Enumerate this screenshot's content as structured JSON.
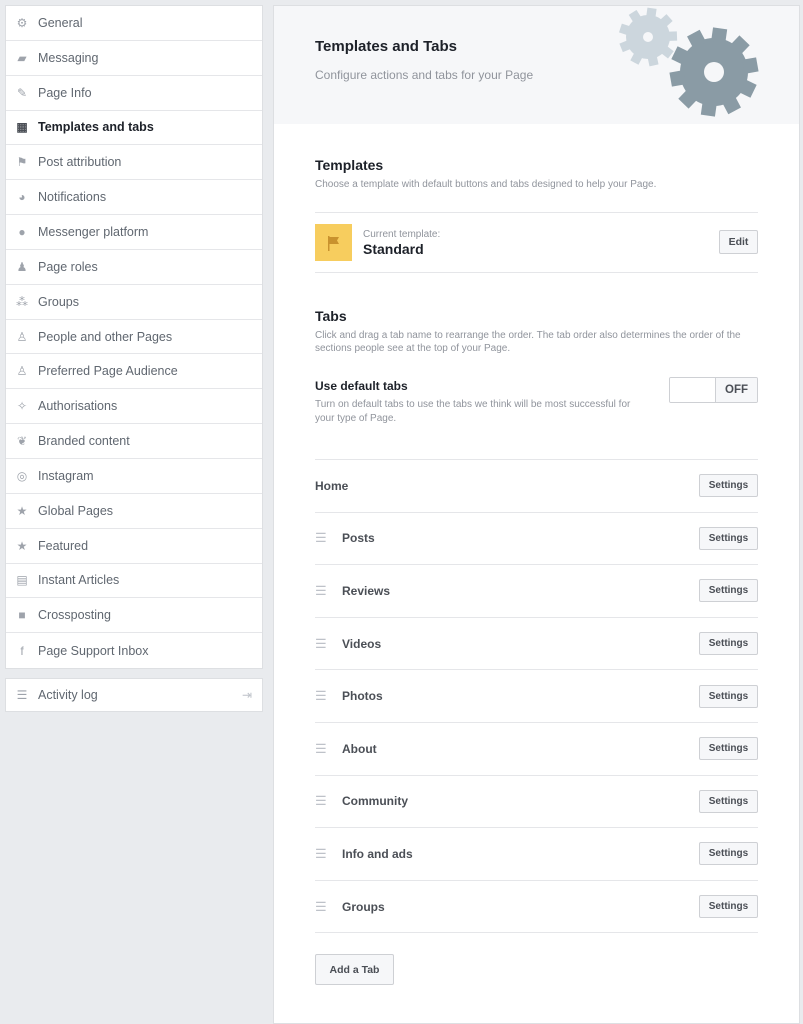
{
  "sidebar": {
    "items": [
      {
        "label": "General",
        "icon": "gear-icon",
        "glyph": "⚙"
      },
      {
        "label": "Messaging",
        "icon": "messaging-icon",
        "glyph": "▰"
      },
      {
        "label": "Page Info",
        "icon": "pencil-icon",
        "glyph": "✎"
      },
      {
        "label": "Templates and tabs",
        "icon": "grid-icon",
        "glyph": "▦",
        "active": true
      },
      {
        "label": "Post attribution",
        "icon": "flag-icon",
        "glyph": "⚑"
      },
      {
        "label": "Notifications",
        "icon": "globe-icon",
        "glyph": "◕"
      },
      {
        "label": "Messenger platform",
        "icon": "messenger-icon",
        "glyph": "●"
      },
      {
        "label": "Page roles",
        "icon": "person-icon",
        "glyph": "♟"
      },
      {
        "label": "Groups",
        "icon": "groups-icon",
        "glyph": "⁂"
      },
      {
        "label": "People and other Pages",
        "icon": "people-icon",
        "glyph": "♙"
      },
      {
        "label": "Preferred Page Audience",
        "icon": "audience-icon",
        "glyph": "♙"
      },
      {
        "label": "Authorisations",
        "icon": "wrench-icon",
        "glyph": "✧"
      },
      {
        "label": "Branded content",
        "icon": "handshake-icon",
        "glyph": "❦"
      },
      {
        "label": "Instagram",
        "icon": "instagram-icon",
        "glyph": "◎"
      },
      {
        "label": "Global Pages",
        "icon": "star-icon",
        "glyph": "★"
      },
      {
        "label": "Featured",
        "icon": "star-icon",
        "glyph": "★"
      },
      {
        "label": "Instant Articles",
        "icon": "article-icon",
        "glyph": "▤"
      },
      {
        "label": "Crossposting",
        "icon": "video-camera-icon",
        "glyph": "■"
      },
      {
        "label": "Page Support Inbox",
        "icon": "facebook-icon",
        "glyph": "f"
      }
    ],
    "activity_log": {
      "label": "Activity log",
      "icon": "list-icon",
      "glyph": "☰",
      "exit_glyph": "⇥"
    }
  },
  "hero": {
    "title": "Templates and Tabs",
    "subtitle": "Configure actions and tabs for your Page"
  },
  "templates": {
    "title": "Templates",
    "description": "Choose a template with default buttons and tabs designed to help your Page.",
    "current_label": "Current template:",
    "current_value": "Standard",
    "edit_label": "Edit"
  },
  "tabs_section": {
    "title": "Tabs",
    "description": "Click and drag a tab name to rearrange the order. The tab order also determines the order of the sections people see at the top of your Page.",
    "default_tabs_title": "Use default tabs",
    "default_tabs_desc": "Turn on default tabs to use the tabs we think will be most successful for your type of Page.",
    "toggle_state": "OFF",
    "settings_label": "Settings",
    "add_tab_label": "Add a Tab",
    "tabs": [
      {
        "name": "Home",
        "draggable": false
      },
      {
        "name": "Posts",
        "draggable": true
      },
      {
        "name": "Reviews",
        "draggable": true
      },
      {
        "name": "Videos",
        "draggable": true
      },
      {
        "name": "Photos",
        "draggable": true
      },
      {
        "name": "About",
        "draggable": true
      },
      {
        "name": "Community",
        "draggable": true
      },
      {
        "name": "Info and ads",
        "draggable": true
      },
      {
        "name": "Groups",
        "draggable": true
      }
    ]
  },
  "colors": {
    "template_icon_bg": "#f7cd5e",
    "gear_light": "#ccd6dd",
    "gear_dark": "#8a9ba5"
  }
}
